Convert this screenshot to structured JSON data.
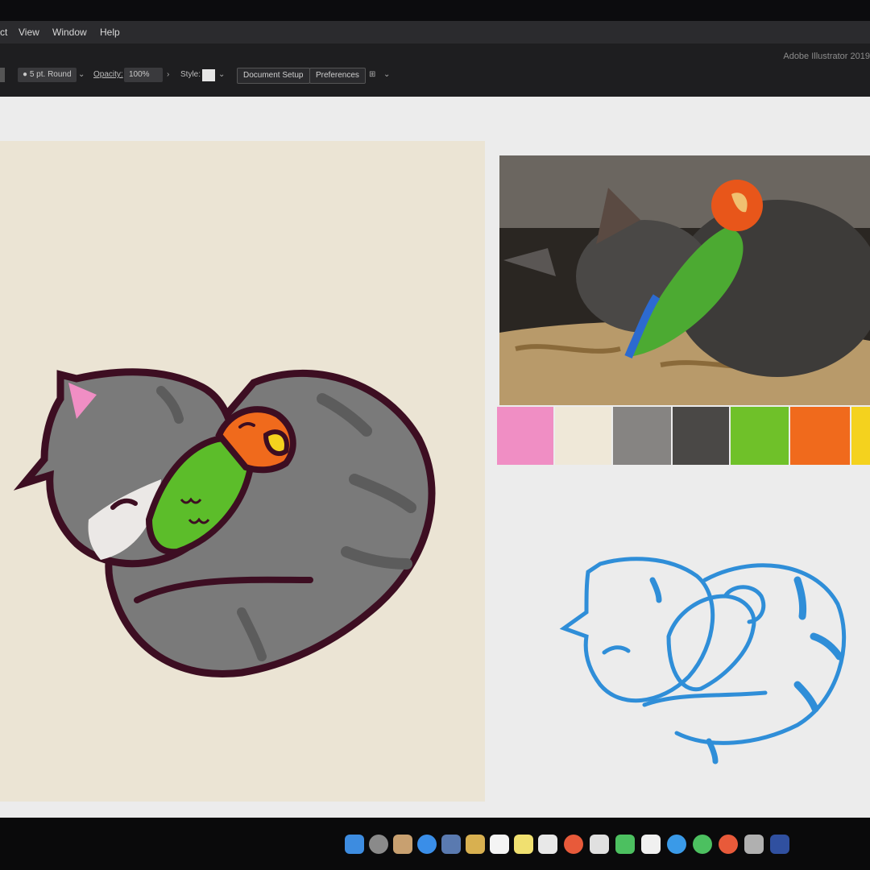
{
  "menu": {
    "items": [
      "ct",
      "View",
      "Window",
      "Help"
    ]
  },
  "controlbar": {
    "app_title": "Adobe Illustrator 2019",
    "stroke_profile": "5 pt. Round",
    "opacity_label": "Opacity:",
    "opacity_value": "100%",
    "style_label": "Style:",
    "document_setup": "Document Setup",
    "preferences": "Preferences"
  },
  "palette": {
    "colors": [
      "#f08ec4",
      "#efe8d8",
      "#868482",
      "#4a4846",
      "#6fc129",
      "#f06a1c",
      "#f4d21e"
    ]
  },
  "illustration": {
    "outline": "#3d0e22",
    "cat_gray": "#7a7a7a",
    "stripe": "#5c5c5c",
    "parrot_green": "#5cbd2a",
    "parrot_orange": "#f06a1c",
    "beak_yellow": "#f4d21e",
    "ear_pink": "#f08ec4"
  },
  "sketch": {
    "stroke": "#2f8ed8"
  },
  "dock": {
    "icons": [
      "finder-icon",
      "launchpad-icon",
      "photo-icon",
      "safari-icon",
      "preview-icon",
      "notes-icon",
      "calendar-icon",
      "stickies-icon",
      "document-icon",
      "chrome-icon",
      "photos-icon",
      "messages-icon",
      "music-icon",
      "app-store-icon",
      "app-icon",
      "app-icon",
      "app-icon",
      "app-icon"
    ]
  }
}
